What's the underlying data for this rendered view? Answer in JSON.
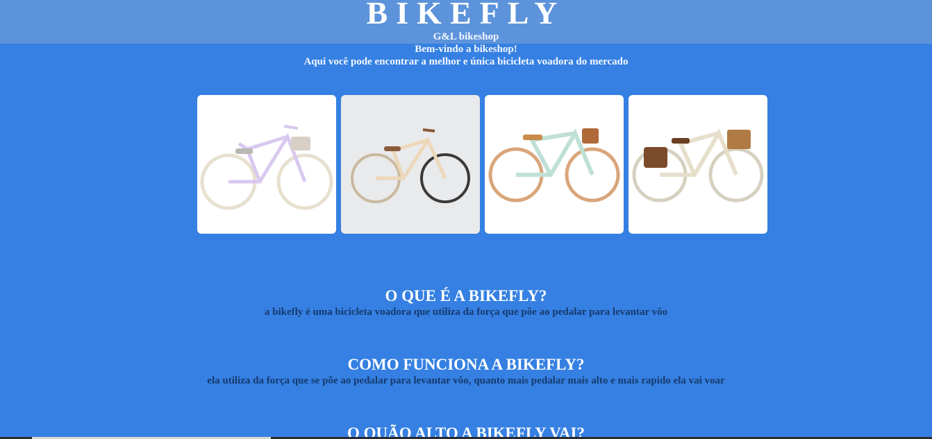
{
  "header": {
    "brand": "BIKEFLY",
    "shop_name": "G&L bikeshop",
    "welcome": "Bem-vindo a bikeshop!",
    "tagline": "Aqui você pode encontrar a melhor e única bicicleta voadora do mercado"
  },
  "gallery": [
    {
      "frame_color": "#d9c8ef",
      "accent_color": "#b9b8b4"
    },
    {
      "frame_color": "#ecd7b9",
      "accent_color": "#8a5a3b"
    },
    {
      "frame_color": "#bfe0d6",
      "accent_color": "#c98a4a"
    },
    {
      "frame_color": "#e6dfcc",
      "accent_color": "#7b4b2a"
    }
  ],
  "sections": [
    {
      "title": "O QUE É A BIKEFLY?",
      "text": "a bikefly é uma bicicleta voadora que utiliza da força que põe ao pedalar para levantar vôo"
    },
    {
      "title": "COMO FUNCIONA A BIKEFLY?",
      "text": "ela utiliza da força que se põe ao pedalar para levantar vôo, quanto mais pedalar mais alto e mais rapido ela vai voar"
    },
    {
      "title": "O QUÃO ALTO A BIKEFLY VAI?",
      "text": ""
    }
  ],
  "colors": {
    "background": "#3580e2",
    "header_bar": "#6290c8",
    "section_text": "#163a6e"
  }
}
